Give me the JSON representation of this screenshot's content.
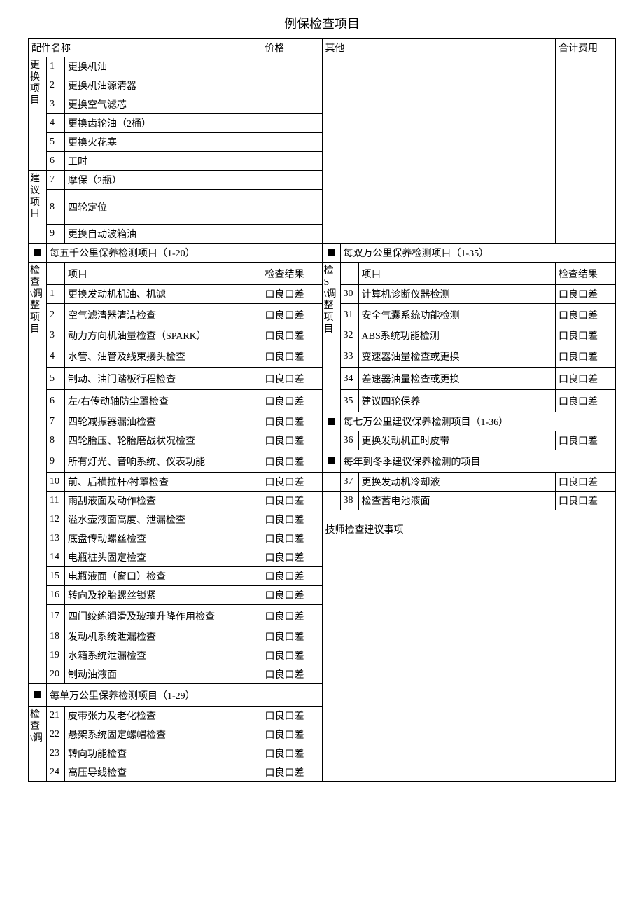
{
  "title": "例保检查项目",
  "headers": {
    "part_name": "配件名称",
    "price": "价格",
    "other": "其他",
    "total": "合计费用",
    "item": "项目",
    "result": "检查结果"
  },
  "sections": {
    "replace": "更换项目",
    "suggest": "建议项目",
    "check_adjust": "检查\\调整项目",
    "check_adjust2": "检查\\调",
    "check_s_adjust": "检S\\调整项目"
  },
  "replace_items": [
    {
      "n": "1",
      "t": "更换机油"
    },
    {
      "n": "2",
      "t": "更换机油源清器"
    },
    {
      "n": "3",
      "t": "更换空气滤芯"
    },
    {
      "n": "4",
      "t": "更换齿轮油（2桶）"
    },
    {
      "n": "5",
      "t": "更换火花塞"
    },
    {
      "n": "6",
      "t": "工时"
    }
  ],
  "suggest_items": [
    {
      "n": "7",
      "t": "摩保（2瓶）"
    },
    {
      "n": "8",
      "t": "四轮定位"
    },
    {
      "n": "9",
      "t": "更换自动波箱油"
    }
  ],
  "bands": {
    "five_k": "每五千公里保养检测项目（1-20）",
    "twenty_k": "每双万公里保养检测项目（1-35）",
    "ten_k": "每单万公里保养检测项目（1-29）",
    "seventy_k": "每七万公里建议保养检测项目（1-36）",
    "winter": "每年到冬季建议保养检测的项目",
    "tech": "技师检查建议事项"
  },
  "r": "口良口差",
  "left_check": [
    {
      "n": "1",
      "t": "更换发动机机油、机滤"
    },
    {
      "n": "2",
      "t": "空气滤清器清洁检查"
    },
    {
      "n": "3",
      "t": "动力方向机油量检查（SPARK）"
    },
    {
      "n": "4",
      "t": "水管、油管及线束接头检查"
    },
    {
      "n": "5",
      "t": "制动、油门踏板行程检查"
    },
    {
      "n": "6",
      "t": "左/右传动轴防尘罩检查"
    },
    {
      "n": "7",
      "t": "四轮减振器漏油检查"
    },
    {
      "n": "8",
      "t": "四轮胎压、轮胎磨战状况检查"
    },
    {
      "n": "9",
      "t": "所有灯光、音响系统、仪表功能"
    },
    {
      "n": "10",
      "t": "前、后横拉杆/衬罩检查"
    },
    {
      "n": "11",
      "t": "雨刮液面及动作检查"
    },
    {
      "n": "12",
      "t": "溢水壶液面高度、泄漏检查"
    },
    {
      "n": "13",
      "t": "底盘传动螺丝检查"
    },
    {
      "n": "14",
      "t": "电瓶桩头固定检查"
    },
    {
      "n": "15",
      "t": "电瓶液面（窗口）检查"
    },
    {
      "n": "16",
      "t": "转向及轮胎螺丝锁紧"
    },
    {
      "n": "17",
      "t": "四门绞练润滑及玻璃升降作用检查"
    },
    {
      "n": "18",
      "t": "发动机系统泄漏检查"
    },
    {
      "n": "19",
      "t": "水箱系统泄漏检查"
    },
    {
      "n": "20",
      "t": "制动油液面"
    }
  ],
  "left_check2": [
    {
      "n": "21",
      "t": "皮带张力及老化检查"
    },
    {
      "n": "22",
      "t": "悬架系统固定螺帽检查"
    },
    {
      "n": "23",
      "t": "转向功能检查"
    },
    {
      "n": "24",
      "t": "高压导线检查"
    }
  ],
  "right_check": [
    {
      "n": "30",
      "t": "计算机诊断仪器检测"
    },
    {
      "n": "31",
      "t": "安全气囊系统功能检测"
    },
    {
      "n": "32",
      "t": "ABS系统功能检测"
    },
    {
      "n": "33",
      "t": "变速器油量检查或更换"
    },
    {
      "n": "34",
      "t": "差速器油量检查或更换"
    },
    {
      "n": "35",
      "t": "建议四轮保养"
    }
  ],
  "right_36": {
    "n": "36",
    "t": "更换发动机正时皮带"
  },
  "right_winter": [
    {
      "n": "37",
      "t": "更换发动机冷却液"
    },
    {
      "n": "38",
      "t": "检查蓄电池液面"
    }
  ]
}
